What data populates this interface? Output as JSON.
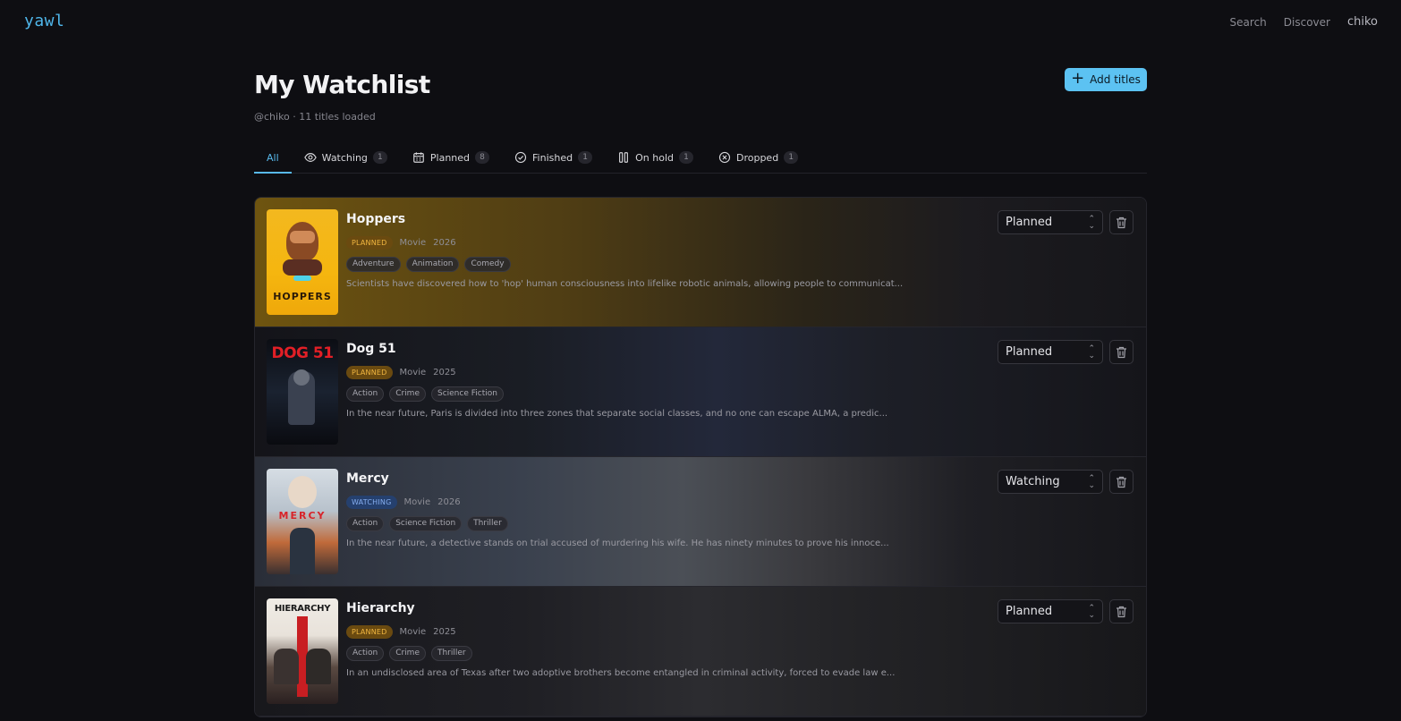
{
  "app": {
    "logo": "yawl",
    "nav": {
      "search": "Search",
      "discover": "Discover",
      "user": "chiko"
    }
  },
  "header": {
    "title": "My Watchlist",
    "subtitle": "@chiko · 11 titles loaded",
    "add_button": "Add titles"
  },
  "tabs": [
    {
      "label": "All",
      "icon": "none",
      "count": ""
    },
    {
      "label": "Watching",
      "icon": "eye-icon",
      "count": "1"
    },
    {
      "label": "Planned",
      "icon": "calendar-icon",
      "count": "8"
    },
    {
      "label": "Finished",
      "icon": "check-circle-icon",
      "count": "1"
    },
    {
      "label": "On hold",
      "icon": "pause-icon",
      "count": "1"
    },
    {
      "label": "Dropped",
      "icon": "x-circle-icon",
      "count": "1"
    }
  ],
  "items": [
    {
      "title": "Hoppers",
      "status_badge": "PLANNED",
      "type": "Movie",
      "year": "2026",
      "genres": [
        "Adventure",
        "Animation",
        "Comedy"
      ],
      "description": "Scientists have discovered how to 'hop' human consciousness into lifelike robotic animals, allowing people to communicat...",
      "status_value": "Planned",
      "poster_text": "HOPPERS"
    },
    {
      "title": "Dog 51",
      "status_badge": "PLANNED",
      "type": "Movie",
      "year": "2025",
      "genres": [
        "Action",
        "Crime",
        "Science Fiction"
      ],
      "description": "In the near future, Paris is divided into three zones that separate social classes, and no one can escape ALMA, a predic...",
      "status_value": "Planned",
      "poster_text": "DOG 51"
    },
    {
      "title": "Mercy",
      "status_badge": "WATCHING",
      "type": "Movie",
      "year": "2026",
      "genres": [
        "Action",
        "Science Fiction",
        "Thriller"
      ],
      "description": "In the near future, a detective stands on trial accused of murdering his wife. He has ninety minutes to prove his innoce...",
      "status_value": "Watching",
      "poster_text": "MERCY"
    },
    {
      "title": "Hierarchy",
      "status_badge": "PLANNED",
      "type": "Movie",
      "year": "2025",
      "genres": [
        "Action",
        "Crime",
        "Thriller"
      ],
      "description": "In an undisclosed area of Texas after two adoptive brothers become entangled in criminal activity, forced to evade law e...",
      "status_value": "Planned",
      "poster_text": "HIERARCHY"
    }
  ]
}
